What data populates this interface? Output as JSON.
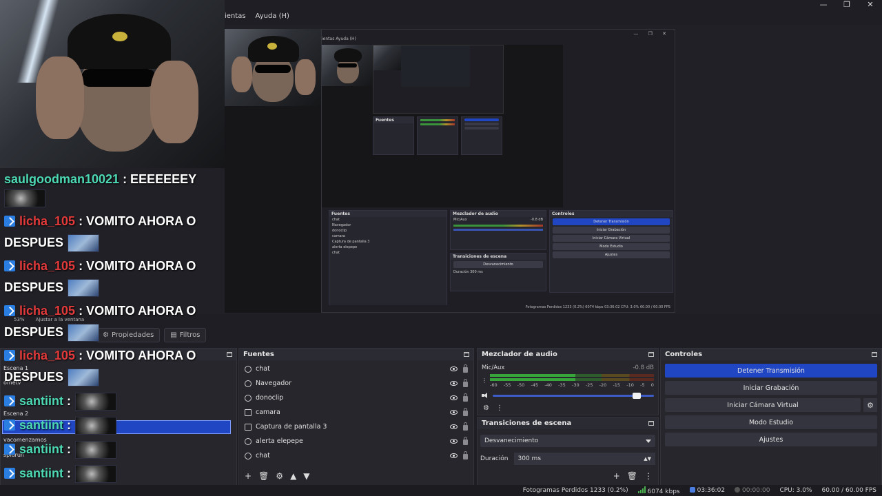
{
  "window": {
    "minimize": "—",
    "maximize": "❐",
    "close": "✕"
  },
  "menu": {
    "items": [
      "ientas",
      "Ayuda (H)"
    ]
  },
  "preview": {
    "zoom": "53%",
    "fit": "Ajustar a la ventana"
  },
  "nested_obs": {
    "menu": "ientas   Ayuda (H)",
    "sources_header": "Fuentes",
    "mixer_header": "Mezclador de audio",
    "controls_header": "Controles",
    "transitions_header": "Transiciones de escena",
    "sources": [
      "chat",
      "Navegador",
      "donoclip",
      "camara",
      "Captura de pantalla 3",
      "alerta elepepe",
      "chat"
    ],
    "mixer_channel": "Mic/Aux",
    "mixer_db": "-0.8 dB",
    "transition": "Desvanecimiento",
    "duration_label": "Duración",
    "duration_value": "300 ms",
    "controls": [
      "Detener Transmisión",
      "Iniciar Grabación",
      "Iniciar Cámara Virtual",
      "Modo Estudio",
      "Ajustes"
    ],
    "status": "Fotogramas Perdidos 1233 (0.2%)   6074 kbps   03:36:02   CPU: 3.0%   60.00 / 60.00 FPS",
    "tabs": [
      "Propiedades",
      "Filtros"
    ]
  },
  "chat": [
    {
      "user": "saulgoodman10021",
      "color": "green",
      "msg": " : EEEEEEEY",
      "badge": false,
      "emote": "dark"
    },
    {
      "user": "licha_105",
      "color": "red",
      "msg": " : VOMITO AHORA O",
      "badge": true,
      "emote": ""
    },
    {
      "user": "",
      "color": "red",
      "msg": "DESPUES",
      "badge": false,
      "emote": "blue"
    },
    {
      "user": "licha_105",
      "color": "red",
      "msg": " : VOMITO AHORA O",
      "badge": true,
      "emote": ""
    },
    {
      "user": "",
      "color": "red",
      "msg": "DESPUES",
      "badge": false,
      "emote": "blue"
    },
    {
      "user": "licha_105",
      "color": "red",
      "msg": " : VOMITO AHORA O",
      "badge": true,
      "emote": ""
    },
    {
      "user": "",
      "color": "red",
      "msg": "DESPUES",
      "badge": false,
      "emote": "blue"
    },
    {
      "user": "licha_105",
      "color": "red",
      "msg": " : VOMITO AHORA O",
      "badge": true,
      "emote": ""
    },
    {
      "user": "",
      "color": "red",
      "msg": "DESPUES",
      "badge": false,
      "emote": "blue"
    },
    {
      "user": "santiint",
      "color": "green",
      "msg": " :",
      "badge": true,
      "emote": "dark"
    },
    {
      "user": "santiint",
      "color": "green",
      "msg": " :",
      "badge": true,
      "emote": "dark"
    },
    {
      "user": "santiint",
      "color": "green",
      "msg": " :",
      "badge": true,
      "emote": "dark"
    },
    {
      "user": "santiint",
      "color": "green",
      "msg": " :",
      "badge": true,
      "emote": "dark"
    }
  ],
  "toolbar": {
    "properties": "Propiedades",
    "filters": "Filtros"
  },
  "scenes": {
    "items": [
      "Escena 1",
      "ometv",
      "Escena 2",
      "vacomenzamos",
      "spidrun"
    ]
  },
  "sources": {
    "title": "Fuentes",
    "items": [
      {
        "label": "chat",
        "icon": "globe-icon"
      },
      {
        "label": "Navegador",
        "icon": "globe-icon"
      },
      {
        "label": "donoclip",
        "icon": "globe-icon"
      },
      {
        "label": "camara",
        "icon": "camera-icon"
      },
      {
        "label": "Captura de pantalla 3",
        "icon": "monitor-icon"
      },
      {
        "label": "alerta elepepe",
        "icon": "globe-icon"
      },
      {
        "label": "chat",
        "icon": "globe-icon"
      }
    ],
    "footer": [
      "+",
      "🗑",
      "⚙",
      "▲",
      "▼"
    ]
  },
  "mixer": {
    "title": "Mezclador de audio",
    "channel": "Mic/Aux",
    "db": "-0.8 dB",
    "scale": [
      "-60",
      "-55",
      "-50",
      "-45",
      "-40",
      "-35",
      "-30",
      "-25",
      "-20",
      "-15",
      "-10",
      "-5",
      "0"
    ],
    "volume_level": 0.92
  },
  "transitions": {
    "title": "Transiciones de escena",
    "selected": "Desvanecimiento",
    "duration_label": "Duración",
    "duration_value": "300 ms"
  },
  "controls": {
    "title": "Controles",
    "stop_stream": "Detener Transmisión",
    "start_recording": "Iniciar Grabación",
    "start_virtual_cam": "Iniciar Cámara Virtual",
    "studio_mode": "Modo Estudio",
    "settings": "Ajustes"
  },
  "status": {
    "dropped_frames": "Fotogramas Perdidos 1233 (0.2%)",
    "bitrate": "6074 kbps",
    "live_time": "03:36:02",
    "rec_time": "00:00:00",
    "cpu": "CPU: 3.0%",
    "fps": "60.00 / 60.00 FPS"
  },
  "colors": {
    "accent": "#2146c4",
    "username_green": "#4cd9b4",
    "username_red": "#e23a3a",
    "panel_bg": "#26262c"
  }
}
